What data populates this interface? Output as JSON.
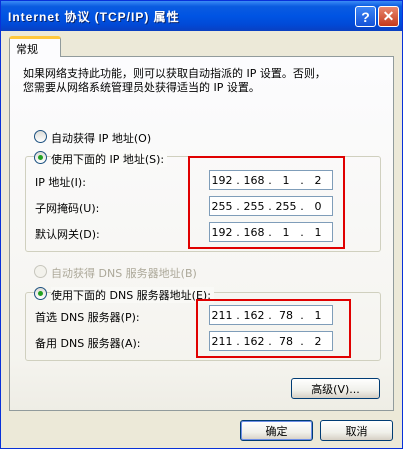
{
  "window": {
    "title": "Internet 协议 (TCP/IP) 属性",
    "help_label": "?",
    "close_label": "✕"
  },
  "tab": {
    "label": "常规"
  },
  "description": {
    "line1": "如果网络支持此功能，则可以获取自动指派的 IP 设置。否则，",
    "line2": "您需要从网络系统管理员处获得适当的 IP 设置。"
  },
  "ip": {
    "auto_label": "自动获得 IP 地址(O)",
    "manual_label": "使用下面的 IP 地址(S):",
    "address_label": "IP 地址(I):",
    "subnet_label": "子网掩码(U):",
    "gateway_label": "默认网关(D):",
    "address": [
      "192",
      "168",
      "1",
      "2"
    ],
    "subnet": [
      "255",
      "255",
      "255",
      "0"
    ],
    "gateway": [
      "192",
      "168",
      "1",
      "1"
    ]
  },
  "dns": {
    "auto_label": "自动获得 DNS 服务器地址(B)",
    "manual_label": "使用下面的 DNS 服务器地址(E):",
    "preferred_label": "首选 DNS 服务器(P):",
    "alternate_label": "备用 DNS 服务器(A):",
    "preferred": [
      "211",
      "162",
      "78",
      "1"
    ],
    "alternate": [
      "211",
      "162",
      "78",
      "2"
    ]
  },
  "buttons": {
    "advanced": "高级(V)...",
    "ok": "确定",
    "cancel": "取消"
  },
  "colors": {
    "title_bar": "#0054e3",
    "highlight": "#e00000",
    "radio_selected": "#21a121"
  }
}
